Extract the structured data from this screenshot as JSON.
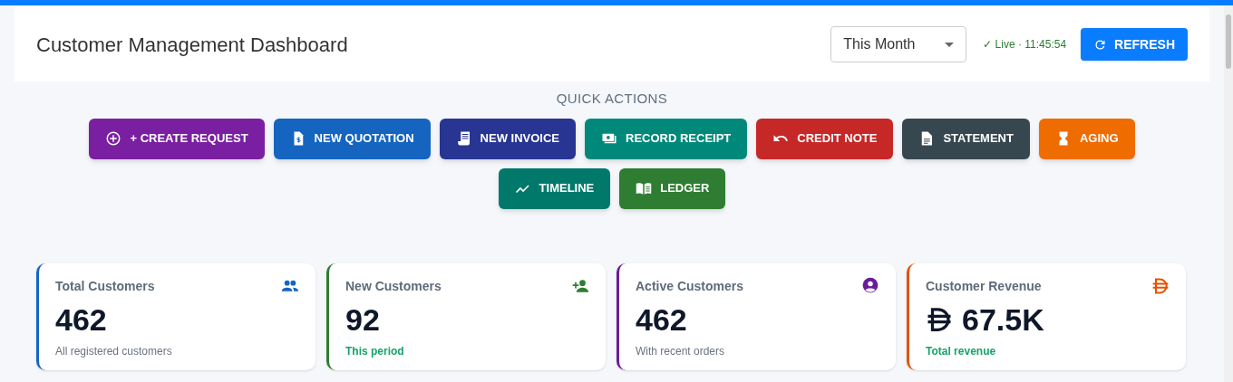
{
  "header": {
    "title": "Customer Management Dashboard",
    "period": {
      "value": "This Month"
    },
    "live_status": "✓ Live · 11:45:54",
    "refresh_button": "REFRESH"
  },
  "quick_actions": {
    "title": "QUICK ACTIONS",
    "buttons": [
      {
        "label": "+ CREATE REQUEST",
        "color": "#7b1fa2"
      },
      {
        "label": "NEW QUOTATION",
        "color": "#1565c0"
      },
      {
        "label": "NEW INVOICE",
        "color": "#283593"
      },
      {
        "label": "RECORD RECEIPT",
        "color": "#00897b"
      },
      {
        "label": "CREDIT NOTE",
        "color": "#c62828"
      },
      {
        "label": "STATEMENT",
        "color": "#37474f"
      },
      {
        "label": "AGING",
        "color": "#ef6c00"
      },
      {
        "label": "TIMELINE",
        "color": "#00796b"
      },
      {
        "label": "LEDGER",
        "color": "#2e7d32"
      }
    ]
  },
  "stat_cards": [
    {
      "title": "Total Customers",
      "value": "462",
      "subtitle": "All registered customers",
      "highlighted": false,
      "color": "#1565c0"
    },
    {
      "title": "New Customers",
      "value": "92",
      "subtitle": "This period",
      "highlighted": true,
      "color": "#2e7d32"
    },
    {
      "title": "Active Customers",
      "value": "462",
      "subtitle": "With recent orders",
      "highlighted": false,
      "color": "#6a1b9a"
    },
    {
      "title": "Customer Revenue",
      "value": "67.5K",
      "subtitle": "Total revenue",
      "highlighted": true,
      "color": "#e65100",
      "currency": true
    }
  ]
}
